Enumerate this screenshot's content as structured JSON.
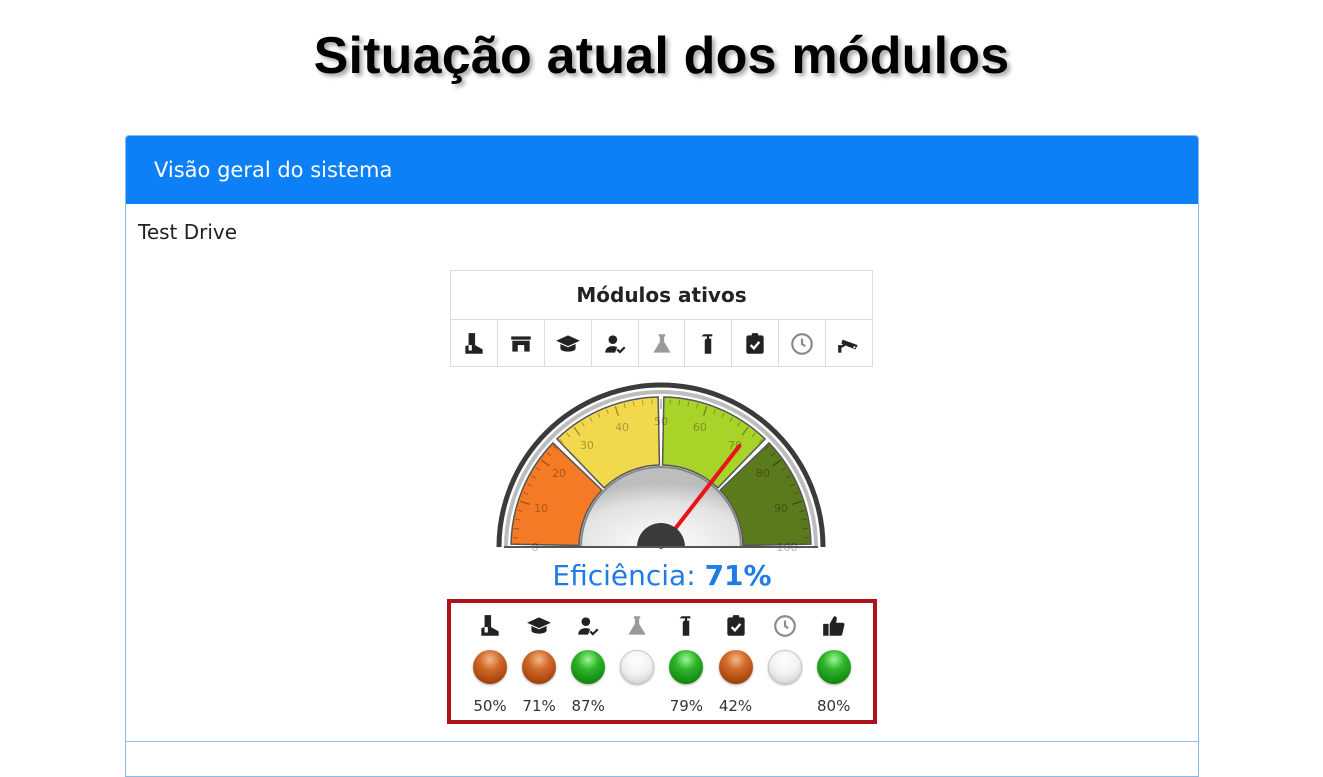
{
  "slide": {
    "title": "Situação atual dos módulos"
  },
  "card": {
    "header": "Visão geral do sistema",
    "subtitle": "Test Drive",
    "modules": {
      "title": "Módulos ativos",
      "icons": [
        "boot-icon",
        "store-icon",
        "graduation-cap-icon",
        "user-check-icon",
        "flask-icon",
        "fire-extinguisher-icon",
        "clipboard-check-icon",
        "clock-icon",
        "security-camera-icon"
      ]
    },
    "gauge": {
      "value": 71,
      "min": 0,
      "max": 100,
      "ticks": [
        "0",
        "10",
        "20",
        "30",
        "40",
        "50",
        "60",
        "70",
        "80",
        "90",
        "100"
      ],
      "colors": {
        "low": "#f47a26",
        "mid": "#f2d84c",
        "high": "#a8d42a",
        "top": "#5a7a1c",
        "needle": "#e8141b"
      }
    },
    "efficiency": {
      "label": "Eficiência:",
      "value": "71%"
    },
    "status": [
      {
        "icon": "boot-icon",
        "state": "orange",
        "percent": "50%"
      },
      {
        "icon": "graduation-cap-icon",
        "state": "orange",
        "percent": "71%"
      },
      {
        "icon": "user-check-icon",
        "state": "green",
        "percent": "87%"
      },
      {
        "icon": "flask-icon",
        "state": "empty",
        "percent": ""
      },
      {
        "icon": "fire-extinguisher-icon",
        "state": "green",
        "percent": "79%"
      },
      {
        "icon": "clipboard-check-icon",
        "state": "orange",
        "percent": "42%"
      },
      {
        "icon": "clock-icon",
        "state": "empty",
        "percent": ""
      },
      {
        "icon": "thumbs-up-icon",
        "state": "green",
        "percent": "80%"
      }
    ]
  }
}
